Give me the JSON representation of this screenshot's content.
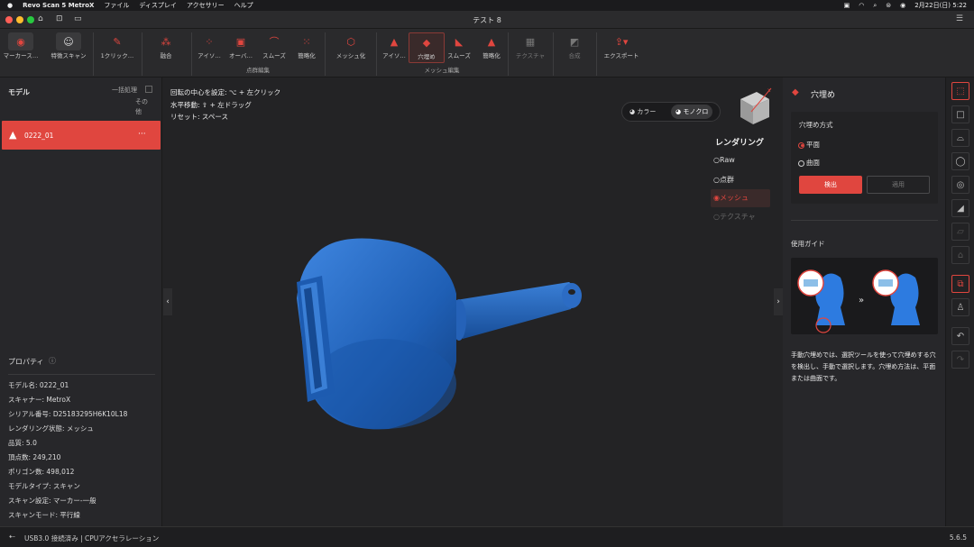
{
  "menubar": {
    "apple": "",
    "app": "Revo Scan 5 MetroX",
    "items": [
      "ファイル",
      "ディスプレイ",
      "アクセサリー",
      "ヘルプ"
    ],
    "datetime": "2月22日(日) 5:22"
  },
  "window": {
    "title": "テスト 8"
  },
  "toolbar": {
    "buttons": [
      {
        "label": "マーカース…",
        "icon": "marker-scan-icon"
      },
      {
        "label": "特徴スキャン",
        "icon": "feature-scan-icon"
      },
      {
        "label": "1クリック…",
        "icon": "one-click-icon"
      },
      {
        "label": "融合",
        "icon": "fusion-icon"
      },
      {
        "label": "アイソ…",
        "icon": "isolate-icon"
      },
      {
        "label": "オーバ…",
        "icon": "overlap-icon"
      },
      {
        "label": "スムーズ",
        "icon": "smooth-icon"
      },
      {
        "label": "簡略化",
        "icon": "simplify-icon"
      },
      {
        "label": "メッシュ化",
        "icon": "meshing-icon"
      },
      {
        "label": "アイソ…",
        "icon": "isolate-icon"
      },
      {
        "label": "穴埋め",
        "icon": "hole-fill-icon"
      },
      {
        "label": "スムーズ",
        "icon": "smooth-icon"
      },
      {
        "label": "簡略化",
        "icon": "simplify-icon"
      },
      {
        "label": "テクスチャ",
        "icon": "texture-icon"
      },
      {
        "label": "合成",
        "icon": "merge-icon"
      },
      {
        "label": "エクスポート",
        "icon": "export-icon"
      }
    ],
    "groups": {
      "pointcloud": "点群編集",
      "mesh": "メッシュ編集"
    }
  },
  "left": {
    "title": "モデル",
    "batch": "一括処理",
    "other": "その他",
    "model": {
      "name": "0222_01",
      "menu": "···"
    },
    "props_title": "プロパティ",
    "props": [
      "モデル名: 0222_01",
      "スキャナー: MetroX",
      "シリアル番号: D25183295H6K10L18",
      "レンダリング状態: メッシュ",
      "品質: 5.0",
      "頂点数: 249,210",
      "ポリゴン数: 498,012",
      "モデルタイプ: スキャン",
      "スキャン設定: マーカー-一般",
      "スキャンモード: 平行線"
    ]
  },
  "viewport": {
    "hints": [
      "回転の中心を設定: ⌥ + 左クリック",
      "水平移動: ⇧ + 左ドラッグ",
      "リセット: スペース"
    ],
    "color_btn": "カラー",
    "mono_btn": "モノクロ",
    "render_title": "レンダリング",
    "render_opts": [
      "Raw",
      "点群",
      "メッシュ",
      "テクスチャ"
    ],
    "render_selected": "メッシュ",
    "mesh_color": "#1f5fb5"
  },
  "right": {
    "title": "穴埋め",
    "method_label": "穴埋め方式",
    "opts": [
      "平面",
      "曲面"
    ],
    "selected": "平面",
    "detect": "検出",
    "apply": "適用",
    "guide_title": "使用ガイド",
    "guide_text": "手動穴埋めでは、選択ツールを使って穴埋めする穴を検出し、手動で選択します。穴埋め方法は、平面または曲面です。"
  },
  "status": {
    "left": "USB3.0 接続済み | CPUアクセラレーション",
    "version": "5.6.5"
  },
  "accent": "#e0463f"
}
